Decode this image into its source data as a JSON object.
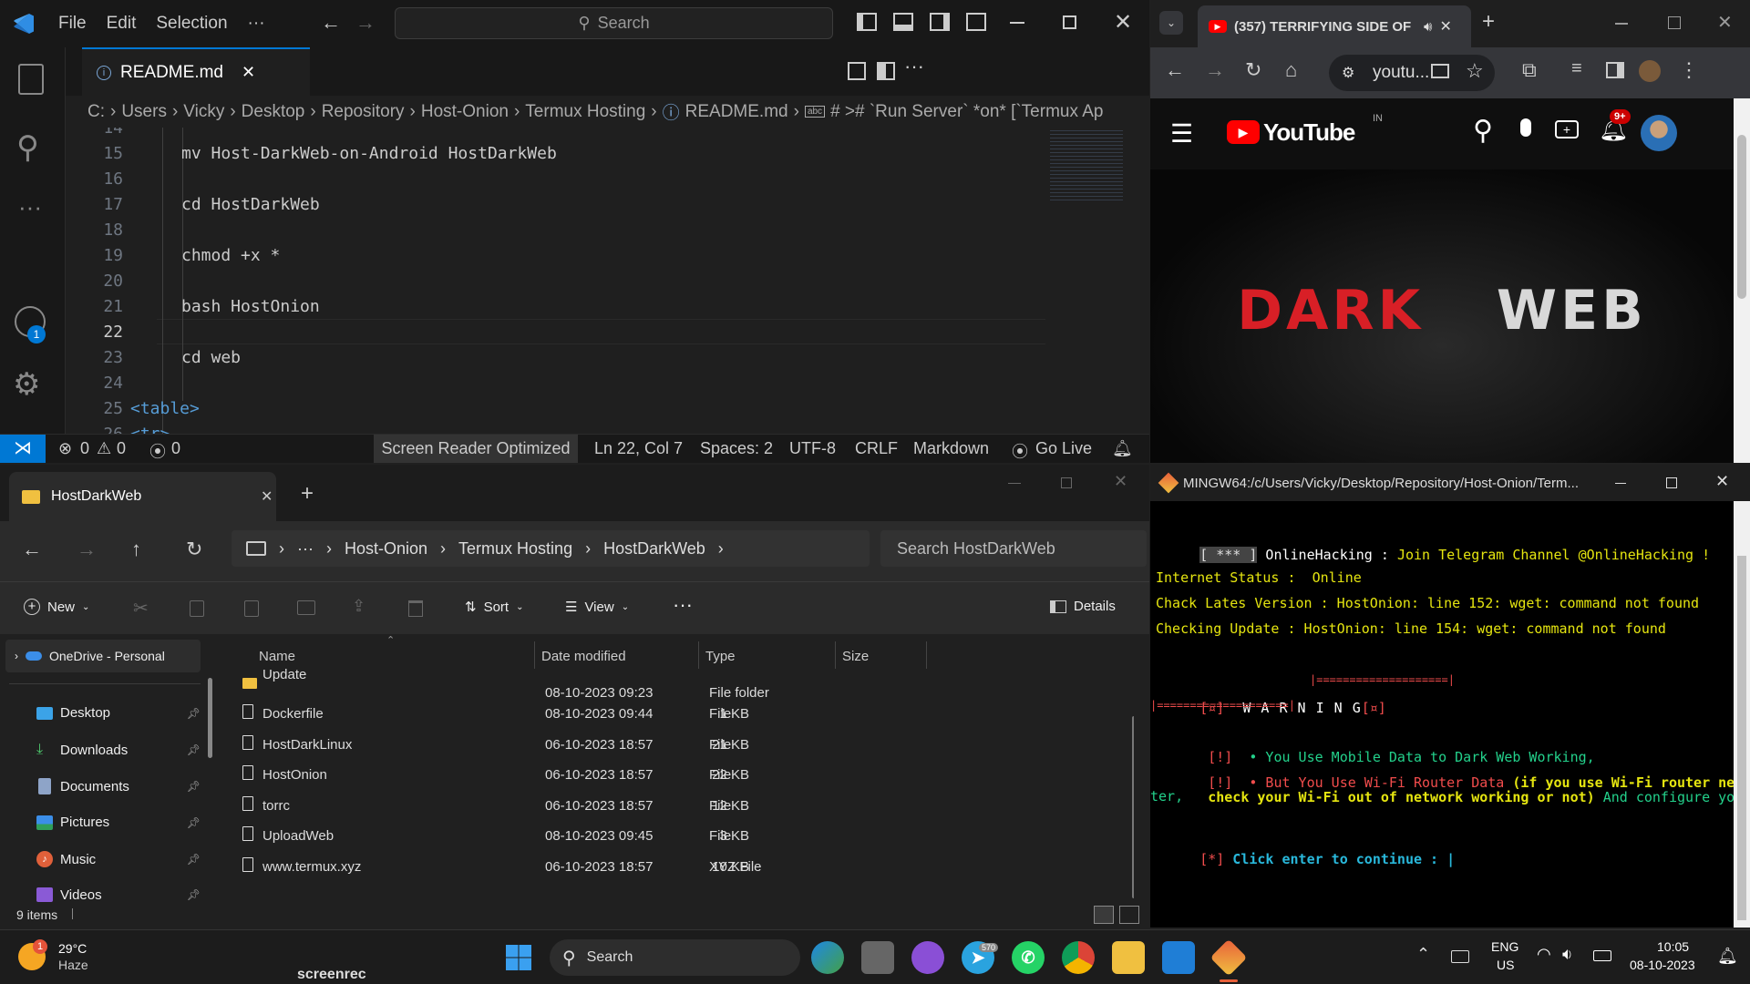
{
  "vscode": {
    "menu": [
      "File",
      "Edit",
      "Selection",
      "···"
    ],
    "search_placeholder": "Search",
    "tab_label": "README.md",
    "account_badge": "1",
    "breadcrumb": [
      "C:",
      "Users",
      "Vicky",
      "Desktop",
      "Repository",
      "Host-Onion",
      "Termux Hosting",
      "README.md",
      "# ># `Run Server` *on* [`Termux Ap"
    ],
    "lines": [
      {
        "n": "14",
        "code": ""
      },
      {
        "n": "15",
        "code": "mv Host-DarkWeb-on-Android HostDarkWeb"
      },
      {
        "n": "16",
        "code": ""
      },
      {
        "n": "17",
        "code": "cd HostDarkWeb"
      },
      {
        "n": "18",
        "code": ""
      },
      {
        "n": "19",
        "code": "chmod +x *"
      },
      {
        "n": "20",
        "code": ""
      },
      {
        "n": "21",
        "code": "bash HostOnion"
      },
      {
        "n": "22",
        "code": ""
      },
      {
        "n": "23",
        "code": "cd web"
      },
      {
        "n": "24",
        "code": ""
      },
      {
        "n": "25",
        "code": "<table>"
      },
      {
        "n": "26",
        "code": "<tr>"
      }
    ],
    "current_line": "22",
    "status": {
      "errors": "0",
      "warnings": "0",
      "ports": "0",
      "screen_reader": "Screen Reader Optimized",
      "position": "Ln 22, Col 7",
      "spaces": "Spaces: 2",
      "encoding": "UTF-8",
      "eol": "CRLF",
      "language": "Markdown",
      "go_live": "Go Live"
    }
  },
  "chrome": {
    "tab_title": "(357) TERRIFYING SIDE OF",
    "url": "youtu...",
    "youtube": {
      "logo": "YouTube",
      "region": "IN",
      "notifications": "9+",
      "hero_word1": "DARK",
      "hero_word2": "WEB"
    }
  },
  "explorer": {
    "tab_title": "HostDarkWeb",
    "address": [
      "···",
      "Host-Onion",
      "Termux Hosting",
      "HostDarkWeb"
    ],
    "search_placeholder": "Search HostDarkWeb",
    "commands": {
      "new": "New",
      "sort": "Sort",
      "view": "View",
      "details": "Details"
    },
    "sidebar": [
      {
        "label": "OneDrive - Personal"
      },
      {
        "label": "Desktop"
      },
      {
        "label": "Downloads"
      },
      {
        "label": "Documents"
      },
      {
        "label": "Pictures"
      },
      {
        "label": "Music"
      },
      {
        "label": "Videos"
      }
    ],
    "columns": [
      "Name",
      "Date modified",
      "Type",
      "Size"
    ],
    "files": [
      {
        "name": "Update",
        "date": "08-10-2023 09:23",
        "type": "File folder",
        "size": ""
      },
      {
        "name": "Dockerfile",
        "date": "08-10-2023 09:44",
        "type": "File",
        "size": "1 KB"
      },
      {
        "name": "HostDarkLinux",
        "date": "06-10-2023 18:57",
        "type": "File",
        "size": "21 KB"
      },
      {
        "name": "HostOnion",
        "date": "06-10-2023 18:57",
        "type": "File",
        "size": "22 KB"
      },
      {
        "name": "torrc",
        "date": "06-10-2023 18:57",
        "type": "File",
        "size": "12 KB"
      },
      {
        "name": "UploadWeb",
        "date": "08-10-2023 09:45",
        "type": "File",
        "size": "3 KB"
      },
      {
        "name": "www.termux.xyz",
        "date": "06-10-2023 18:57",
        "type": "XYZ File",
        "size": "10 KB"
      }
    ],
    "status": "9 items"
  },
  "terminal": {
    "title": "MINGW64:/c/Users/Vicky/Desktop/Repository/Host-Onion/Term...",
    "l1a": "[ *** ]",
    "l1b": " OnlineHacking : ",
    "l1c": "Join Telegram Channel @OnlineHacking !",
    "l2": "Internet Status :  Online",
    "l3": "Chack Lates Version : HostOnion: line 152: wget: command not found",
    "l4": "Checking Update : HostOnion: line 154: wget: command not found",
    "bar": "|====================|",
    "warn_a": "[¤]",
    "warn_b": "  W A R N I N G",
    "warn_c": "[¤]",
    "bar2": "|====================|",
    "m1a": " [!]",
    "m1b": "  • You Use Mobile Data to Dark Web Working,",
    "m2a": " [!]",
    "m2b": "  • But You Use Wi-Fi Router Data",
    "m2c": " (if you use Wi-Fi router network",
    "m3a": " check your Wi-Fi out of network working or not)",
    "m3b": " And configure you rou",
    "m4": "ter,",
    "prompt_a": "[*]",
    "prompt_b": " Click enter to continue : |"
  },
  "taskbar": {
    "weather_temp": "29°C",
    "weather_desc": "Haze",
    "weather_badge": "1",
    "search_label": "Search",
    "telegram_badge": "570",
    "lang1": "ENG",
    "lang2": "US",
    "time": "10:05",
    "date": "08-10-2023",
    "watermark": "screenrec"
  },
  "colors": {
    "vscode_accent": "#0078d4",
    "youtube_red": "#ff0000",
    "terminal_yellow": "#e5e510",
    "terminal_green": "#23d18b",
    "terminal_red": "#f14c4c"
  }
}
